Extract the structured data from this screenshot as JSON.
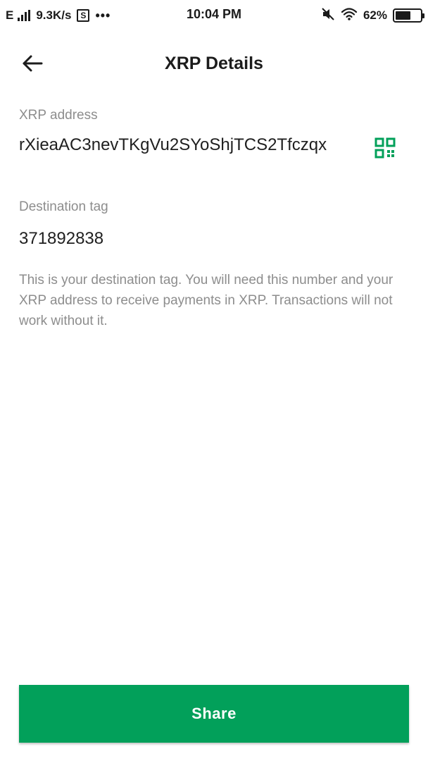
{
  "status_bar": {
    "network_type": "E",
    "speed": "9.3K/s",
    "sim_label": "S",
    "more": "•••",
    "time": "10:04 PM",
    "battery": "62%",
    "battery_level": 0.62
  },
  "header": {
    "title": "XRP Details",
    "back_icon": "arrow-left-icon"
  },
  "address": {
    "label": "XRP address",
    "value": "rXieaAC3nevTKgVu2SYoShjTCS2Tfczqx",
    "qr_icon": "qr-code-icon"
  },
  "tag": {
    "label": "Destination tag",
    "value": "371892838"
  },
  "helper_text": "This is your destination tag. You will need this number and your XRP address to receive payments in XRP. Transactions will not work without it.",
  "actions": {
    "share_label": "Share"
  },
  "colors": {
    "accent": "#02a05a",
    "text_primary": "#1f1f1f",
    "text_secondary": "#8d8d8d"
  }
}
